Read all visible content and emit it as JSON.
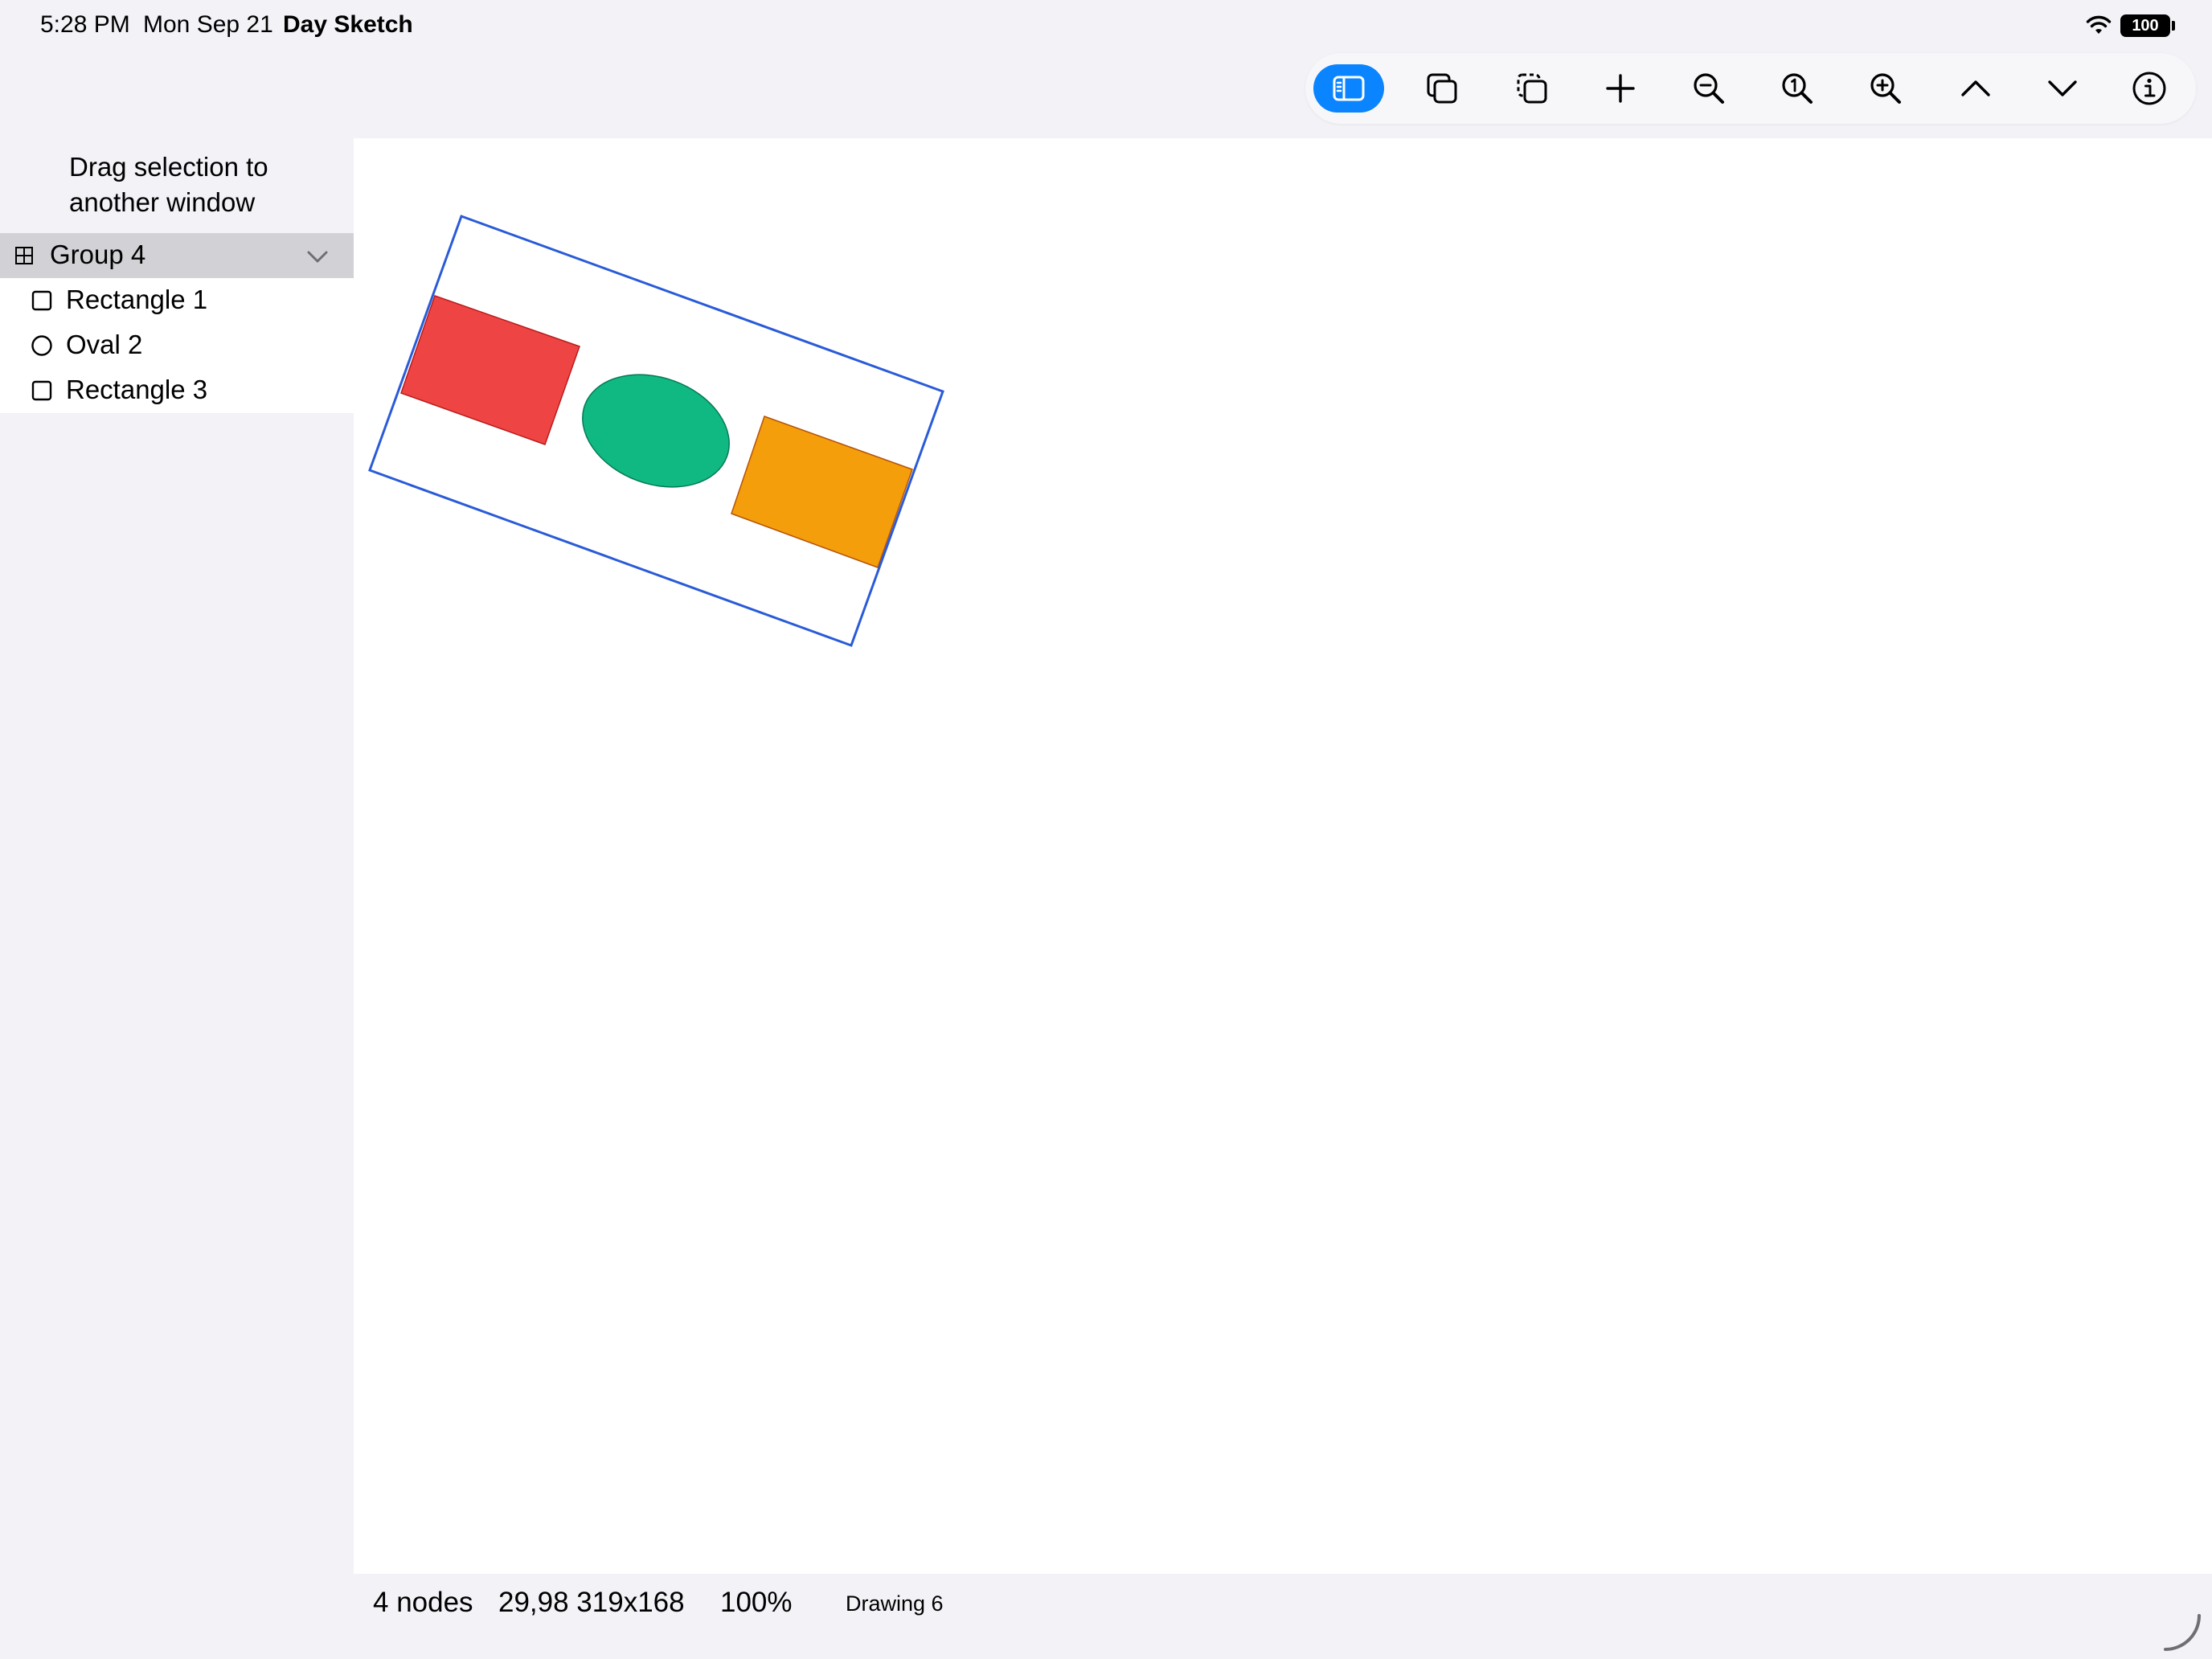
{
  "status_bar": {
    "time": "5:28 PM",
    "date": "Mon Sep 21",
    "app_name": "Day Sketch",
    "battery_level": "100",
    "icons": [
      "wifi-icon",
      "battery-icon"
    ]
  },
  "toolbar": {
    "buttons": [
      {
        "name": "toggle-sidebar",
        "icon": "sidebar-icon",
        "active": true
      },
      {
        "name": "duplicate",
        "icon": "duplicate-icon",
        "active": false
      },
      {
        "name": "paste",
        "icon": "paste-icon",
        "active": false
      },
      {
        "name": "add",
        "icon": "plus-icon",
        "active": false
      },
      {
        "name": "zoom-out",
        "icon": "zoom-out-icon",
        "active": false
      },
      {
        "name": "actual-size",
        "icon": "zoom-actual-icon",
        "active": false
      },
      {
        "name": "zoom-in",
        "icon": "zoom-in-icon",
        "active": false
      },
      {
        "name": "previous",
        "icon": "chevron-up-icon",
        "active": false
      },
      {
        "name": "next",
        "icon": "chevron-down-icon",
        "active": false
      },
      {
        "name": "info",
        "icon": "info-icon",
        "active": false
      }
    ],
    "accent_color": "#0a84ff"
  },
  "sidebar": {
    "hint": "Drag selection to another window",
    "items": [
      {
        "label": "Group 4",
        "icon": "group-icon",
        "selected": true,
        "expanded": true
      },
      {
        "label": "Rectangle 1",
        "icon": "rectangle-icon",
        "selected": false
      },
      {
        "label": "Oval 2",
        "icon": "oval-icon",
        "selected": false
      },
      {
        "label": "Rectangle 3",
        "icon": "rectangle-icon",
        "selected": false
      }
    ]
  },
  "canvas": {
    "shapes": [
      {
        "name": "Rectangle 1",
        "kind": "rectangle",
        "fill": "#ef4444"
      },
      {
        "name": "Oval 2",
        "kind": "oval",
        "fill": "#10b981"
      },
      {
        "name": "Rectangle 3",
        "kind": "rectangle",
        "fill": "#f59e0b"
      }
    ],
    "selection_color": "#2a5bd7"
  },
  "footer": {
    "node_count": "4 nodes",
    "geometry": "29,98 319x168",
    "zoom": "100%",
    "document": "Drawing 6"
  }
}
